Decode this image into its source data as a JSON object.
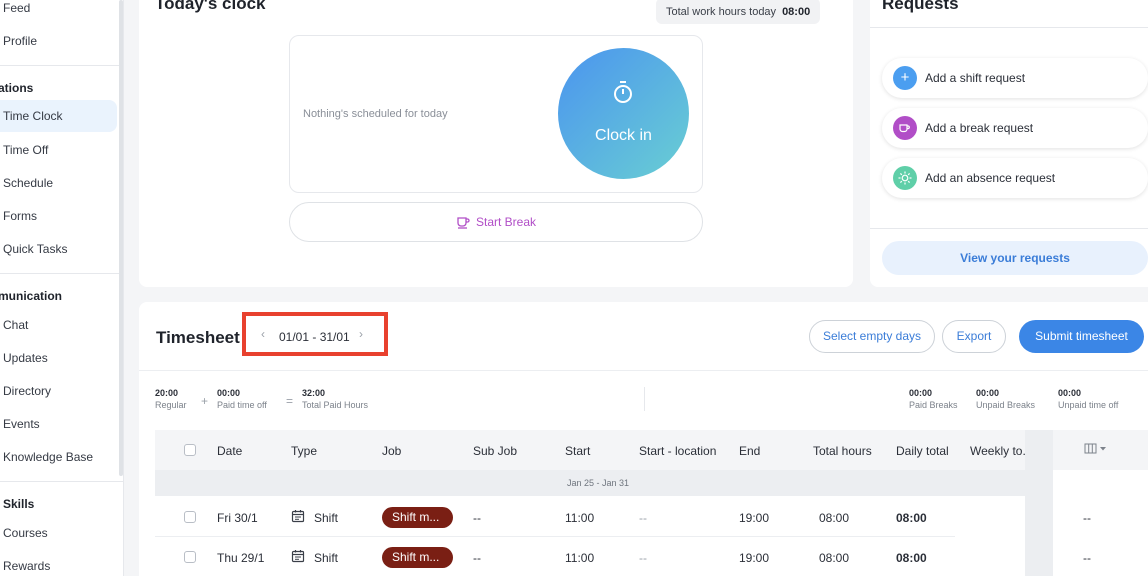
{
  "sidebar": {
    "items": [
      {
        "id": "feed",
        "label": "Feed"
      },
      {
        "id": "profile",
        "label": "Profile"
      },
      {
        "id": "time-clock",
        "label": "Time Clock"
      },
      {
        "id": "time-off",
        "label": "Time Off"
      },
      {
        "id": "schedule",
        "label": "Schedule"
      },
      {
        "id": "forms",
        "label": "Forms"
      },
      {
        "id": "quick-tasks",
        "label": "Quick Tasks"
      },
      {
        "id": "chat",
        "label": "Chat"
      },
      {
        "id": "updates",
        "label": "Updates"
      },
      {
        "id": "directory",
        "label": "Directory"
      },
      {
        "id": "events",
        "label": "Events"
      },
      {
        "id": "knowledge-base",
        "label": "Knowledge Base"
      },
      {
        "id": "courses",
        "label": "Courses"
      },
      {
        "id": "rewards",
        "label": "Rewards"
      }
    ],
    "sections": [
      "ations",
      "munication",
      "Skills"
    ]
  },
  "clock": {
    "title": "Today's clock",
    "hours_label": "Total work hours today",
    "hours_value": "08:00",
    "schedule_text": "Nothing's scheduled for today",
    "clock_in_label": "Clock in",
    "break_label": "Start Break"
  },
  "requests": {
    "title": "Requests",
    "items": [
      {
        "label": "Add a shift request",
        "icon": "plus-icon",
        "color": "#4b9ef0"
      },
      {
        "label": "Add a break request",
        "icon": "coffee-icon",
        "color": "#b14ec7"
      },
      {
        "label": "Add an absence request",
        "icon": "sun-icon",
        "color": "#5fcfa8"
      }
    ],
    "view_label": "View your requests"
  },
  "timesheet": {
    "title": "Timesheet",
    "date_range": "01/01 - 31/01",
    "select_empty_label": "Select empty days",
    "export_label": "Export",
    "submit_label": "Submit timesheet",
    "summary": {
      "regular": {
        "value": "20:00",
        "label": "Regular"
      },
      "paid_time_off": {
        "value": "00:00",
        "label": "Paid time off"
      },
      "total_paid": {
        "value": "32:00",
        "label": "Total Paid Hours"
      },
      "paid_breaks": {
        "value": "00:00",
        "label": "Paid Breaks"
      },
      "unpaid_breaks": {
        "value": "00:00",
        "label": "Unpaid Breaks"
      },
      "unpaid_time_off": {
        "value": "00:00",
        "label": "Unpaid time off"
      },
      "plus": "+",
      "equals": "="
    },
    "columns": [
      "Date",
      "Type",
      "Job",
      "Sub Job",
      "Start",
      "Start - location",
      "End",
      "Total hours",
      "Daily total",
      "Weekly to..."
    ],
    "group_label": "Jan 25 - Jan 31",
    "rows": [
      {
        "date": "Fri 30/1",
        "type": "Shift",
        "job": "Shift m...",
        "sub_job": "--",
        "start": "11:00",
        "start_location": "--",
        "end": "19:00",
        "total": "08:00",
        "daily": "08:00",
        "extra": "--"
      },
      {
        "date": "Thu 29/1",
        "type": "Shift",
        "job": "Shift m...",
        "sub_job": "--",
        "start": "11:00",
        "start_location": "--",
        "end": "19:00",
        "total": "08:00",
        "daily": "08:00",
        "extra": "--"
      }
    ]
  },
  "colors": {
    "accent": "#3b86e6",
    "highlight": "#e8412e",
    "job": "#7a1f14",
    "break": "#b14ec7"
  }
}
